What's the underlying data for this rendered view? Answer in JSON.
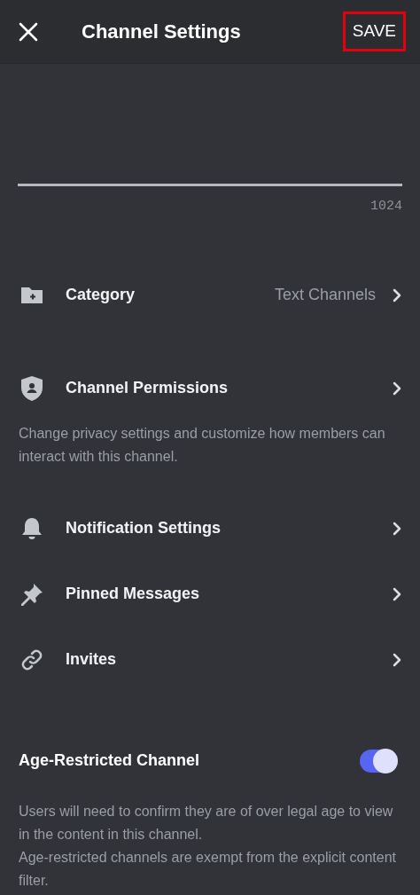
{
  "header": {
    "title": "Channel Settings",
    "save_button": {
      "label": "SAVE",
      "highlighted": true
    }
  },
  "topic_field": {
    "counter": "1024"
  },
  "rows": [
    {
      "label": "Category",
      "value": "Text Channels"
    },
    {
      "label": "Channel Permissions",
      "description": "Change privacy settings and customize how members can interact with this channel."
    },
    {
      "label": "Notification Settings"
    },
    {
      "label": "Pinned Messages"
    },
    {
      "label": "Invites"
    }
  ],
  "age_restricted": {
    "label": "Age-Restricted Channel",
    "on": true,
    "description": [
      "Users will need to confirm they are of over legal age to view in the content in this channel.",
      "Age-restricted channels are exempt from the explicit content filter."
    ]
  }
}
